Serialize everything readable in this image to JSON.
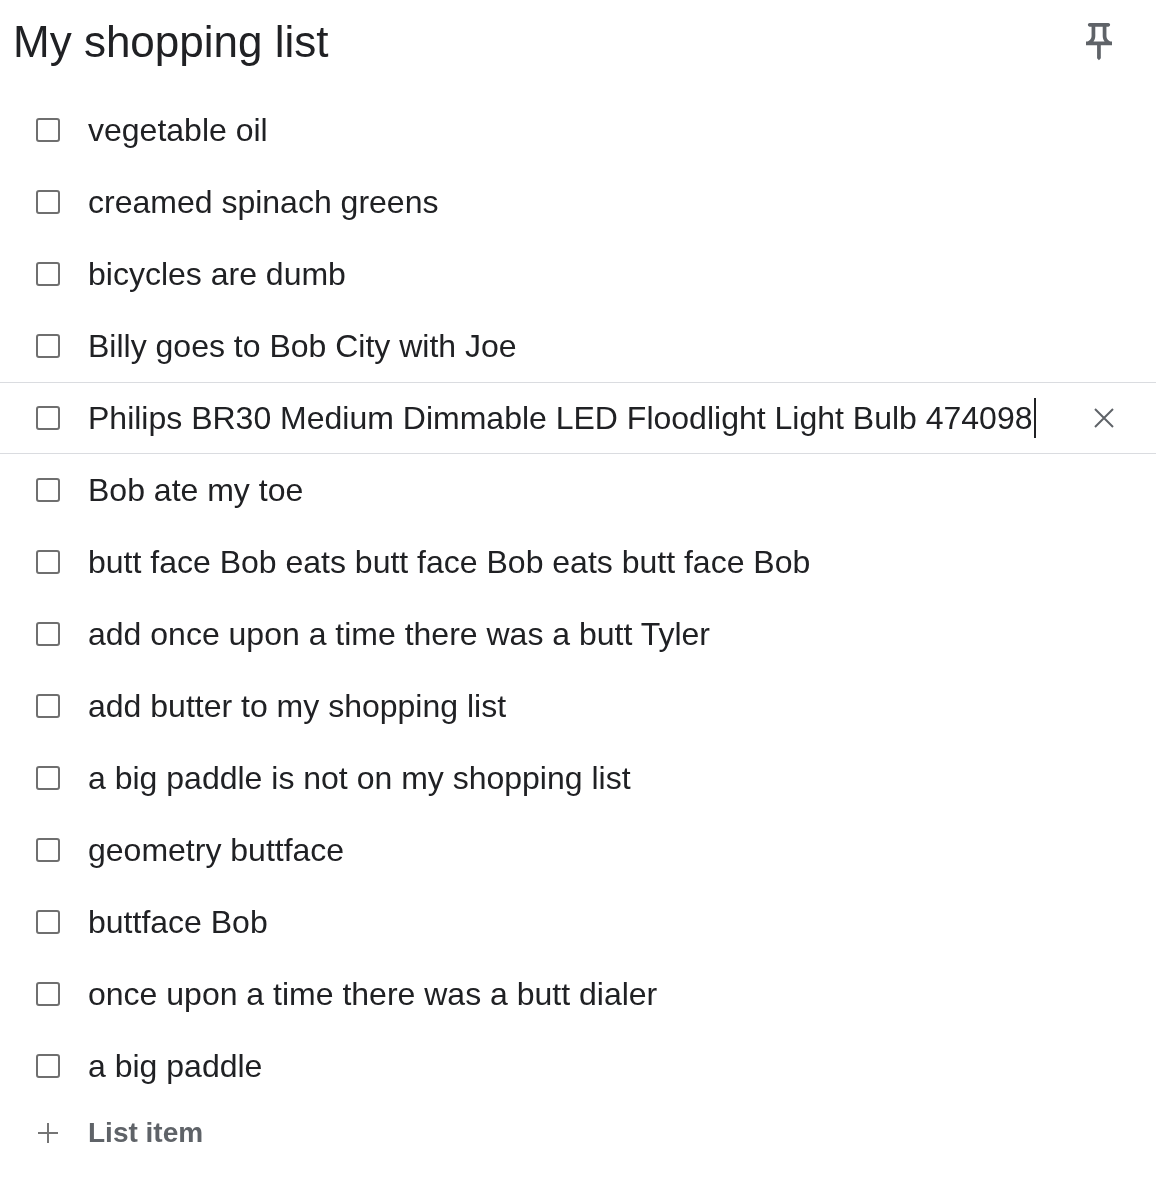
{
  "note": {
    "title": "My shopping list"
  },
  "items": [
    {
      "text": "vegetable oil",
      "checked": false,
      "focused": false
    },
    {
      "text": "creamed spinach greens",
      "checked": false,
      "focused": false
    },
    {
      "text": "bicycles are dumb",
      "checked": false,
      "focused": false
    },
    {
      "text": "Billy goes to Bob City with Joe",
      "checked": false,
      "focused": false
    },
    {
      "text": "Philips BR30 Medium Dimmable LED Floodlight Light Bulb 474098",
      "checked": false,
      "focused": true
    },
    {
      "text": "Bob ate my toe",
      "checked": false,
      "focused": false
    },
    {
      "text": "butt face Bob eats butt face Bob eats butt face Bob",
      "checked": false,
      "focused": false
    },
    {
      "text": "add once upon a time there was a butt Tyler",
      "checked": false,
      "focused": false
    },
    {
      "text": "add butter to my shopping list",
      "checked": false,
      "focused": false
    },
    {
      "text": "a big paddle is not on my shopping list",
      "checked": false,
      "focused": false
    },
    {
      "text": "geometry buttface",
      "checked": false,
      "focused": false
    },
    {
      "text": "buttface Bob",
      "checked": false,
      "focused": false
    },
    {
      "text": "once upon a time there was a butt dialer",
      "checked": false,
      "focused": false
    },
    {
      "text": "a big paddle",
      "checked": false,
      "focused": false
    }
  ],
  "add_item": {
    "placeholder": "List item"
  }
}
